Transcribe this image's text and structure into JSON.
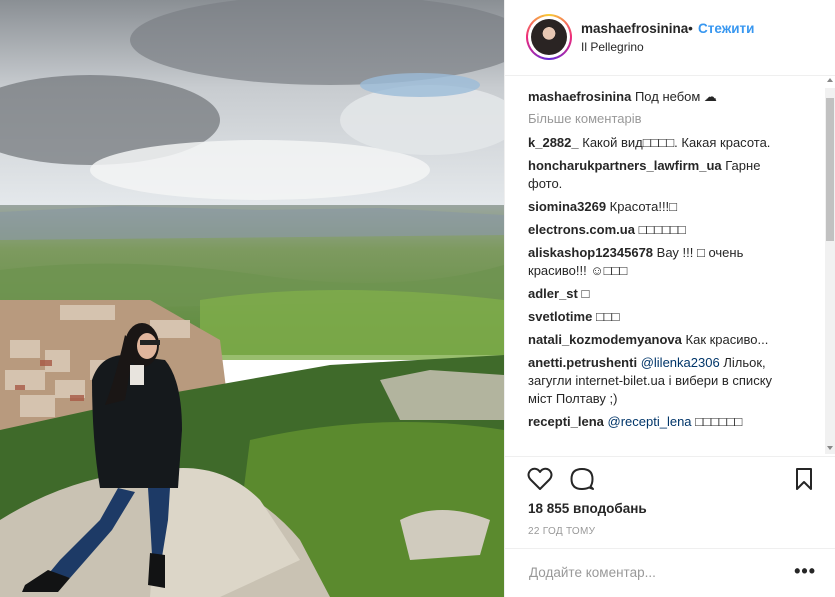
{
  "header": {
    "username": "mashaefrosinina",
    "separator": "•",
    "follow_label": "Стежити",
    "location": "Il Pellegrino"
  },
  "caption": {
    "username": "mashaefrosinina",
    "text": "Под небом ☁"
  },
  "more_comments_label": "Більше коментарів",
  "comments": [
    {
      "user": "k_2882_",
      "text": "Какой вид□□□□. Какая красота."
    },
    {
      "user": "honcharukpartners_lawfirm_ua",
      "text": "Гарне фото."
    },
    {
      "user": "siomina3269",
      "text": "Красота!!!□"
    },
    {
      "user": "electrons.com.ua",
      "text": "□□□□□□"
    },
    {
      "user": "aliskashop12345678",
      "text": "Вау !!! □ очень красиво!!! ☺□□□"
    },
    {
      "user": "adler_st",
      "text": "□"
    },
    {
      "user": "svetlotime",
      "text": "□□□"
    },
    {
      "user": "natali_kozmodemyanova",
      "text": "Как красиво..."
    },
    {
      "user": "anetti.petrushenti",
      "mention": "@lilenka2306",
      "text": "Лільок, загугли internet-bilet.ua і вибери в списку міст Полтаву ;)"
    },
    {
      "user": "recepti_lena",
      "mention": "@recepti_lena",
      "text": "□□□□□□"
    }
  ],
  "actions": {
    "likes": "18 855 вподобань",
    "timestamp": "22 ГОД ТОМУ"
  },
  "add_comment": {
    "placeholder": "Додайте коментар...",
    "more_options": "•••"
  },
  "icons": {
    "like": "heart-icon",
    "comment": "comment-bubble-icon",
    "save": "bookmark-icon",
    "options": "more-options-icon"
  },
  "colors": {
    "link": "#3897f0",
    "mention": "#003569",
    "muted": "#999999",
    "text": "#262626"
  }
}
